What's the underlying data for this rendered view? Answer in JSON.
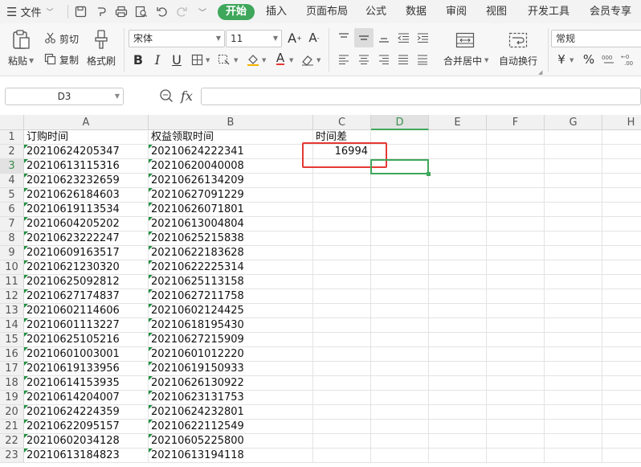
{
  "menu": {
    "file_label": "文件",
    "tabs": [
      "开始",
      "插入",
      "页面布局",
      "公式",
      "数据",
      "审阅",
      "视图",
      "开发工具",
      "会员专享"
    ],
    "active_tab": "开始"
  },
  "ribbon": {
    "paste_label": "粘贴",
    "cut_label": "剪切",
    "copy_label": "复制",
    "format_painter_label": "格式刷",
    "font_name": "宋体",
    "font_size": "11",
    "merge_label": "合并居中",
    "wrap_label": "自动换行",
    "number_format": "常规",
    "currency_symbol": "¥",
    "percent_symbol": "%"
  },
  "formula_bar": {
    "cell_ref": "D3",
    "fx_label": "fx",
    "formula_value": ""
  },
  "grid": {
    "columns": [
      "A",
      "B",
      "C",
      "D",
      "E",
      "F",
      "G",
      "H"
    ],
    "selected_column": "D",
    "selected_row": "3",
    "rows": [
      {
        "n": "1",
        "a": "订购时间",
        "b": "权益领取时间",
        "c": "时间差"
      },
      {
        "n": "2",
        "a": "20210624205347",
        "b": "20210624222341",
        "c": "16994"
      },
      {
        "n": "3",
        "a": "20210613115316",
        "b": "20210620040008",
        "c": ""
      },
      {
        "n": "4",
        "a": "20210623232659",
        "b": "20210626134209",
        "c": ""
      },
      {
        "n": "5",
        "a": "20210626184603",
        "b": "20210627091229",
        "c": ""
      },
      {
        "n": "6",
        "a": "20210619113534",
        "b": "20210626071801",
        "c": ""
      },
      {
        "n": "7",
        "a": "20210604205202",
        "b": "20210613004804",
        "c": ""
      },
      {
        "n": "8",
        "a": "20210623222247",
        "b": "20210625215838",
        "c": ""
      },
      {
        "n": "9",
        "a": "20210609163517",
        "b": "20210622183628",
        "c": ""
      },
      {
        "n": "10",
        "a": "20210621230320",
        "b": "20210622225314",
        "c": ""
      },
      {
        "n": "11",
        "a": "20210625092812",
        "b": "20210625113158",
        "c": ""
      },
      {
        "n": "12",
        "a": "20210627174837",
        "b": "20210627211758",
        "c": ""
      },
      {
        "n": "13",
        "a": "20210602114606",
        "b": "20210602124425",
        "c": ""
      },
      {
        "n": "14",
        "a": "20210601113227",
        "b": "20210618195430",
        "c": ""
      },
      {
        "n": "15",
        "a": "20210625105216",
        "b": "20210627215909",
        "c": ""
      },
      {
        "n": "16",
        "a": "20210601003001",
        "b": "20210601012220",
        "c": ""
      },
      {
        "n": "17",
        "a": "20210619133956",
        "b": "20210619150933",
        "c": ""
      },
      {
        "n": "18",
        "a": "20210614153935",
        "b": "20210626130922",
        "c": ""
      },
      {
        "n": "19",
        "a": "20210614204007",
        "b": "20210623131753",
        "c": ""
      },
      {
        "n": "20",
        "a": "20210624224359",
        "b": "20210624232801",
        "c": ""
      },
      {
        "n": "21",
        "a": "20210622095157",
        "b": "20210622112549",
        "c": ""
      },
      {
        "n": "22",
        "a": "20210602034128",
        "b": "20210605225800",
        "c": ""
      },
      {
        "n": "23",
        "a": "20210613184823",
        "b": "20210613194118",
        "c": ""
      }
    ]
  },
  "colors": {
    "accent": "#3fa75b",
    "highlight_box": "#e53935"
  }
}
